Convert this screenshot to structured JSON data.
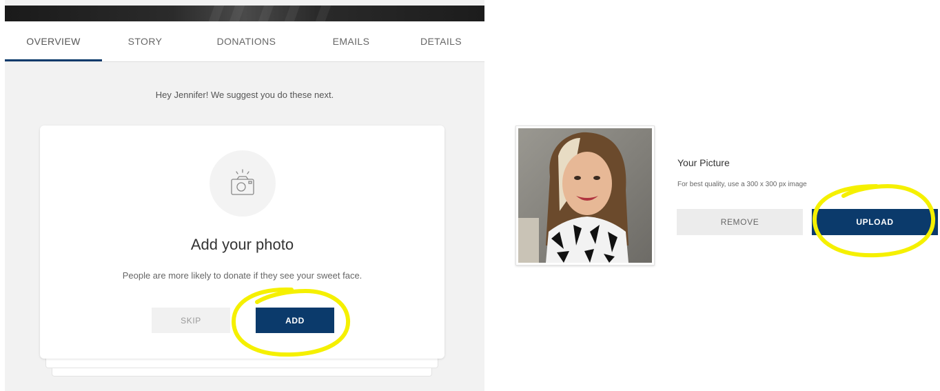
{
  "tabs": [
    {
      "label": "OVERVIEW",
      "active": true
    },
    {
      "label": "STORY",
      "active": false
    },
    {
      "label": "DONATIONS",
      "active": false
    },
    {
      "label": "EMAILS",
      "active": false
    },
    {
      "label": "DETAILS",
      "active": false
    }
  ],
  "suggestion": "Hey Jennifer! We suggest you do these next.",
  "card": {
    "icon": "camera-icon",
    "title": "Add your photo",
    "subtitle": "People are more likely to donate if they see your sweet face.",
    "skip_label": "SKIP",
    "add_label": "ADD"
  },
  "picture": {
    "title": "Your Picture",
    "hint": "For best quality, use a 300 x 300 px image",
    "remove_label": "REMOVE",
    "upload_label": "UPLOAD"
  },
  "colors": {
    "accent": "#0b3a6b",
    "highlight": "#f5f000",
    "panel_bg": "#f2f2f2"
  }
}
